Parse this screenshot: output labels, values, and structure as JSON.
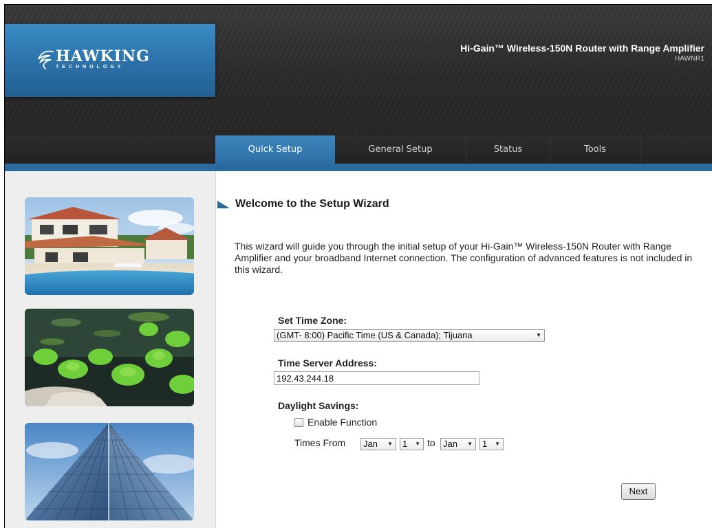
{
  "header": {
    "logo_name": "HAWKING",
    "logo_sub": "TECHNOLOGY",
    "product_title": "Hi-Gain™ Wireless-150N Router with Range Amplifier",
    "model": "HAWNR1"
  },
  "nav": {
    "items": [
      {
        "label": "Quick Setup",
        "active": true
      },
      {
        "label": "General Setup",
        "active": false
      },
      {
        "label": "Status",
        "active": false
      },
      {
        "label": "Tools",
        "active": false
      }
    ]
  },
  "sidebar": {
    "photos": [
      "house-with-pool-photo",
      "pond-plants-photo",
      "glass-pyramid-photo"
    ]
  },
  "main": {
    "title": "Welcome to the Setup Wizard",
    "intro": "This wizard will guide you through the initial setup of your Hi-Gain™ Wireless-150N Router with Range Amplifier and your broadband Internet connection. The configuration of advanced features is not included in this wizard.",
    "time_zone_label": "Set Time Zone:",
    "time_zone_value": "(GMT- 8:00) Pacific Time (US & Canada); Tijuana",
    "time_server_label": "Time Server Address:",
    "time_server_value": "192.43.244.18",
    "daylight_label": "Daylight Savings:",
    "enable_label": "Enable Function",
    "enable_checked": false,
    "times_from_label": "Times From",
    "to_label": "to",
    "from_month": "Jan",
    "from_day": "1",
    "to_month": "Jan",
    "to_day": "1",
    "next_label": "Next"
  },
  "colors": {
    "accent": "#2a6a9d",
    "header_dark": "#2a2a2a"
  }
}
